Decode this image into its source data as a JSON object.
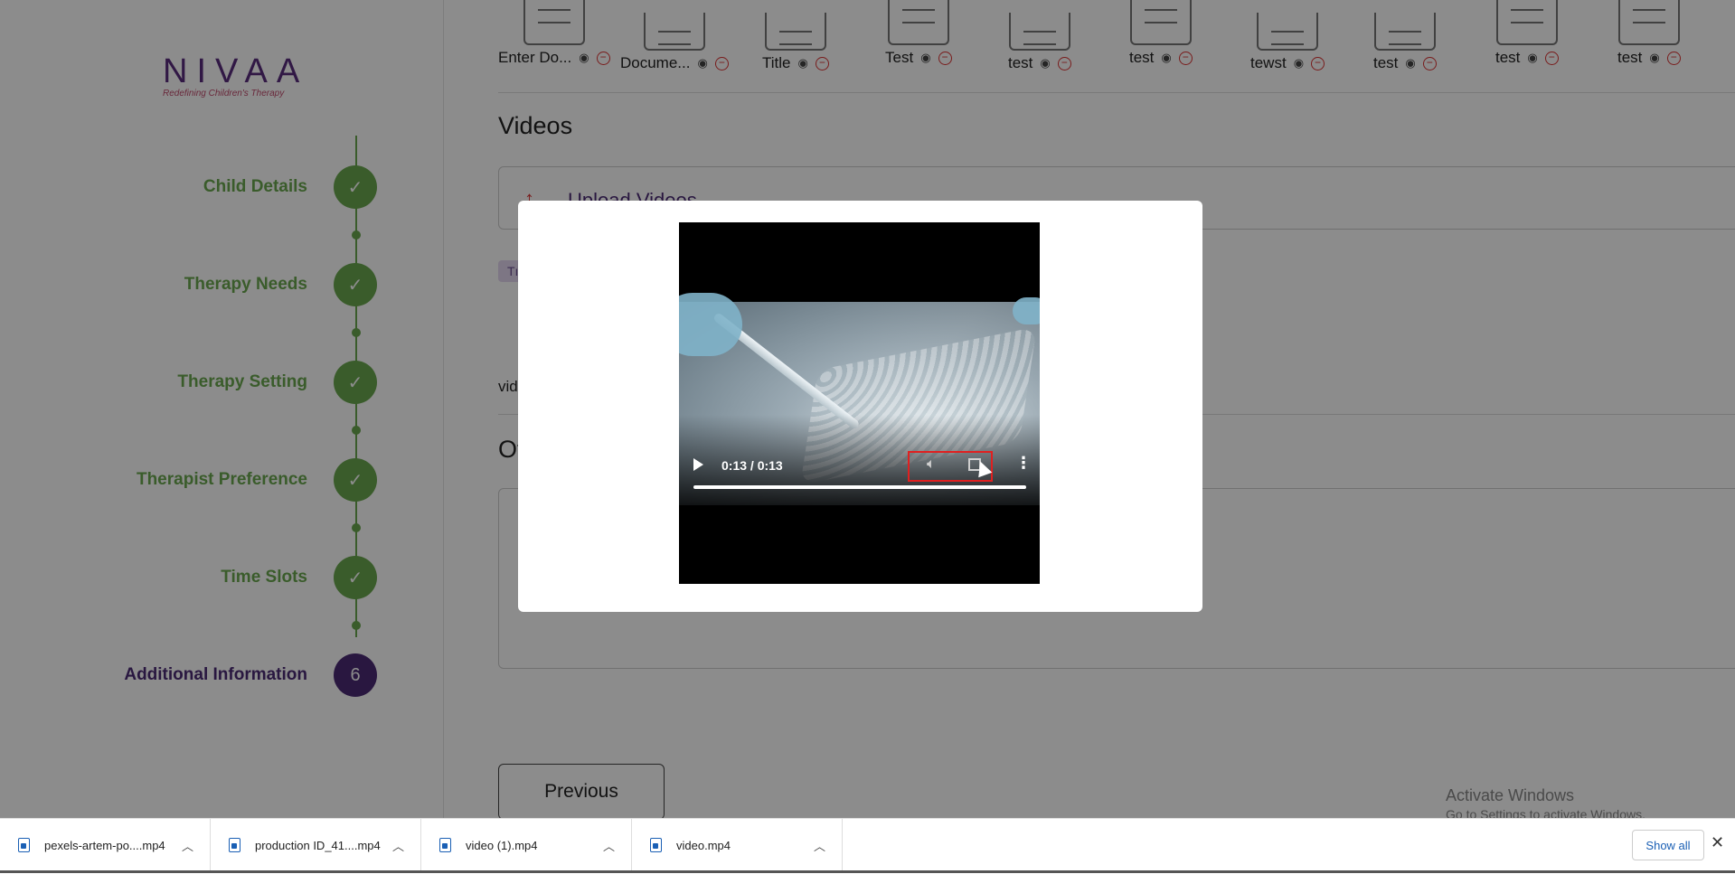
{
  "brand": {
    "name": "NIVAA",
    "tagline": "Redefining Children's Therapy"
  },
  "steps": [
    {
      "label": "Child Details",
      "status": "done",
      "marker": "✓"
    },
    {
      "label": "Therapy Needs",
      "status": "done",
      "marker": "✓"
    },
    {
      "label": "Therapy Setting",
      "status": "done",
      "marker": "✓"
    },
    {
      "label": "Therapist Preference",
      "status": "done",
      "marker": "✓"
    },
    {
      "label": "Time Slots",
      "status": "done",
      "marker": "✓"
    },
    {
      "label": "Additional Information",
      "status": "active",
      "marker": "6"
    }
  ],
  "documents": [
    "Enter Do...",
    "Docume...",
    "Title",
    "Test",
    "test",
    "test",
    "tewst",
    "test",
    "test",
    "test"
  ],
  "videos_section": {
    "title": "Videos",
    "upload_label": "Upload Videos",
    "tag": "Tı",
    "video_text": "vid"
  },
  "other_section": {
    "title": "Ot"
  },
  "previous_label": "Previous",
  "watermark": {
    "line1": "Activate Windows",
    "line2": "Go to Settings to activate Windows."
  },
  "video_player": {
    "time": "0:13 / 0:13",
    "progress": 1.0
  },
  "downloads": [
    {
      "name": "pexels-artem-po....mp4"
    },
    {
      "name": "production ID_41....mp4"
    },
    {
      "name": "video (1).mp4"
    },
    {
      "name": "video.mp4"
    }
  ],
  "show_all_label": "Show all",
  "icons": [
    "document-icon",
    "eye-icon",
    "remove-icon",
    "upload-icon",
    "check-icon",
    "play-icon",
    "volume-icon",
    "fullscreen-icon",
    "more-options-icon",
    "video-file-icon",
    "chevron-up-icon",
    "close-icon"
  ],
  "colors": {
    "done": "#6aa84f",
    "active": "#4b2a76",
    "remove": "#dd3333",
    "highlight": "#e02020",
    "link": "#1a5fb4"
  }
}
